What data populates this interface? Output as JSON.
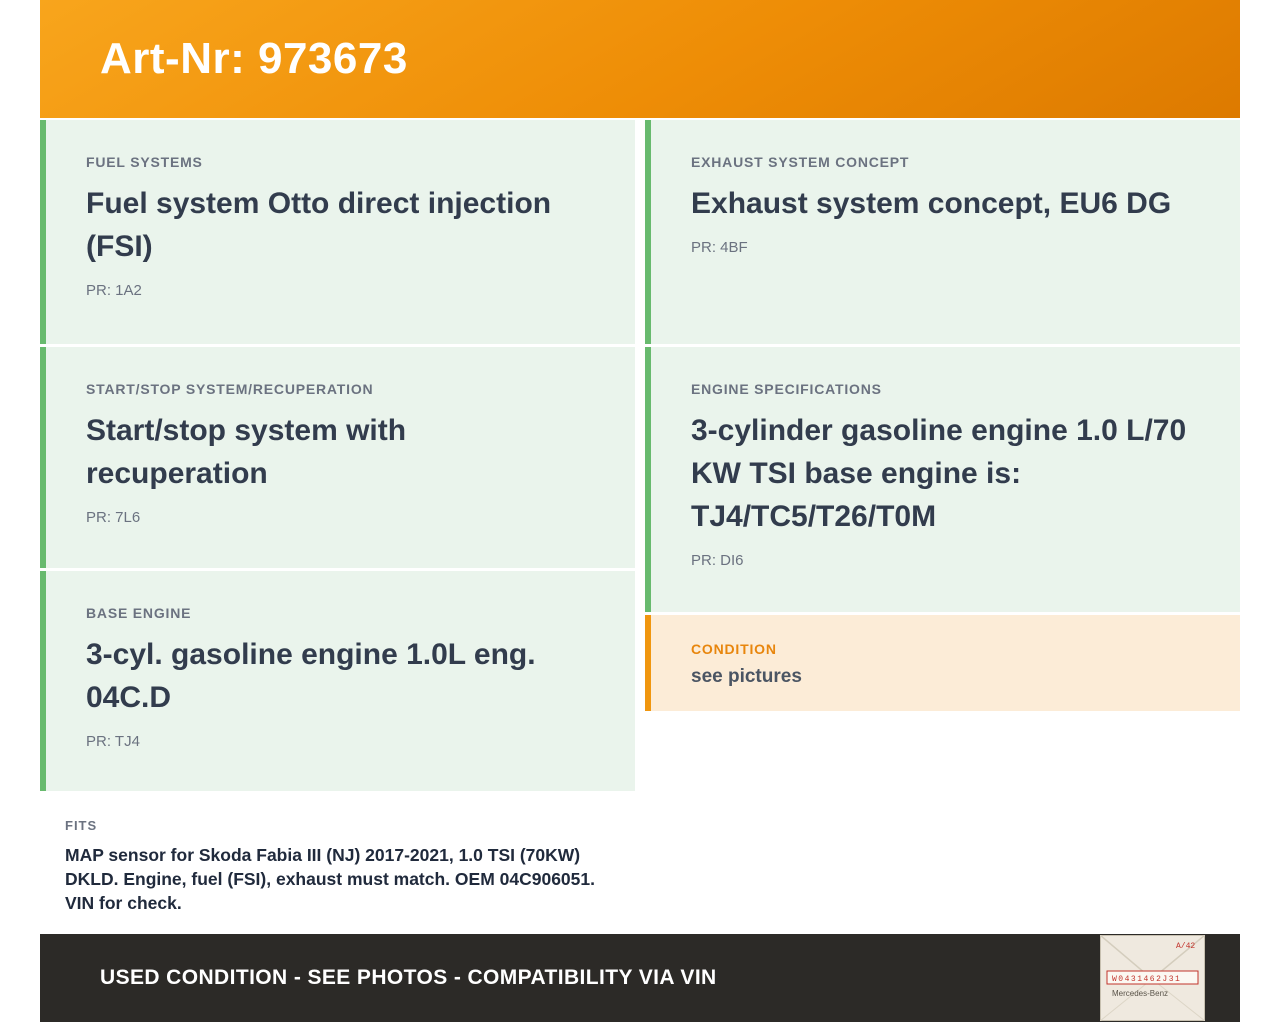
{
  "header": {
    "title": "Art-Nr: 973673"
  },
  "cards": {
    "left": [
      {
        "label": "FUEL SYSTEMS",
        "title": "Fuel system Otto direct injection (FSI)",
        "pr": "PR: 1A2"
      },
      {
        "label": "START/STOP SYSTEM/RECUPERATION",
        "title": "Start/stop system with recuperation",
        "pr": "PR: 7L6"
      },
      {
        "label": "BASE ENGINE",
        "title": "3-cyl. gasoline engine 1.0L eng. 04C.D",
        "pr": "PR: TJ4"
      }
    ],
    "right": [
      {
        "label": "EXHAUST SYSTEM CONCEPT",
        "title": "Exhaust system concept, EU6 DG",
        "pr": "PR: 4BF"
      },
      {
        "label": "ENGINE SPECIFICATIONS",
        "title": "3-cylinder gasoline engine 1.0 L/70 KW TSI base engine is: TJ4/TC5/T26/T0M",
        "pr": "PR: DI6"
      }
    ],
    "condition": {
      "label": "CONDITION",
      "text": "see pictures"
    },
    "fits": {
      "label": "FITS",
      "text": "MAP sensor for Skoda Fabia III (NJ) 2017-2021, 1.0 TSI (70KW) DKLD. Engine, fuel (FSI), exhaust must match. OEM 04C906051. VIN for check."
    }
  },
  "footer": {
    "text": "USED CONDITION - SEE PHOTOS - COMPATIBILITY VIA VIN",
    "sticker": {
      "corner": "A/42",
      "code": "W0431462J31",
      "caption": "Mercedes-Benz"
    }
  },
  "colors": {
    "header_orange": "#ee8d06",
    "card_green_border": "#68ba6e",
    "card_green_bg": "#eaf4ec",
    "condition_orange": "#f0960f",
    "condition_bg": "#fcecd7",
    "footer_bg": "#2c2a27"
  }
}
